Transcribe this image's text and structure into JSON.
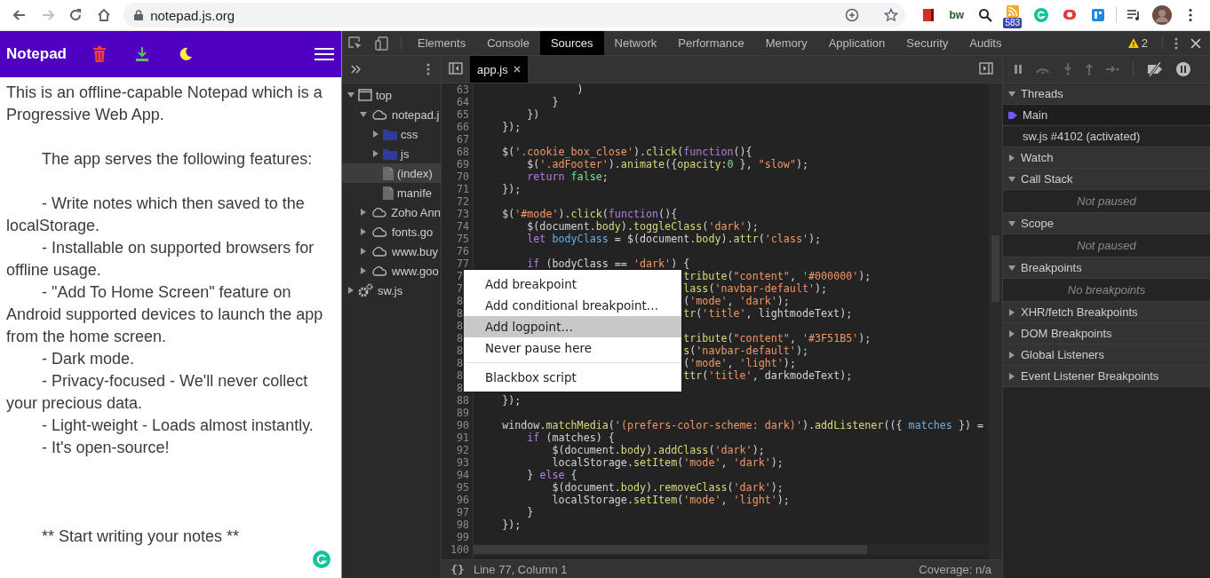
{
  "browser": {
    "address": "notepad.js.org",
    "extension_label": "bw",
    "extension_badge": "583"
  },
  "notepad": {
    "title": "Notepad",
    "text": "This is an offline-capable Notepad which is a Progressive Web App.\n\n\tThe app serves the following features:\n\n\t- Write notes which then saved to the localStorage.\n\t- Installable on supported browsers for offline usage.\n\t- \"Add To Home Screen\" feature on Android supported devices to launch the app from the home screen.\n\t- Dark mode.\n\t- Privacy-focused - We'll never collect your precious data.\n\t- Light-weight - Loads almost instantly.\n\t- It's open-source!\n\n\n\n\t** Start writing your notes **"
  },
  "devtools": {
    "tabs": [
      {
        "label": "Elements",
        "selected": false
      },
      {
        "label": "Console",
        "selected": false
      },
      {
        "label": "Sources",
        "selected": true
      },
      {
        "label": "Network",
        "selected": false
      },
      {
        "label": "Performance",
        "selected": false
      },
      {
        "label": "Memory",
        "selected": false
      },
      {
        "label": "Application",
        "selected": false
      },
      {
        "label": "Security",
        "selected": false
      },
      {
        "label": "Audits",
        "selected": false
      }
    ],
    "warning_count": "2",
    "navigator": {
      "tree": [
        {
          "label": "top",
          "kind": "frame",
          "expanded": true,
          "selected": false,
          "children": [
            {
              "label": "notepad.j",
              "kind": "origin",
              "expanded": true,
              "selected": false,
              "children": [
                {
                  "label": "css",
                  "kind": "folder",
                  "expanded": false,
                  "selected": false
                },
                {
                  "label": "js",
                  "kind": "folder",
                  "expanded": false,
                  "selected": false
                },
                {
                  "label": "(index)",
                  "kind": "file",
                  "selected": true
                },
                {
                  "label": "manife",
                  "kind": "file",
                  "selected": false
                }
              ]
            },
            {
              "label": "Zoho Ann",
              "kind": "origin",
              "expanded": false,
              "selected": false
            },
            {
              "label": "fonts.go",
              "kind": "origin",
              "expanded": false,
              "selected": false
            },
            {
              "label": "www.buy",
              "kind": "origin",
              "expanded": false,
              "selected": false
            },
            {
              "label": "www.goo",
              "kind": "origin",
              "expanded": false,
              "selected": false
            }
          ]
        },
        {
          "label": "sw.js",
          "kind": "worker",
          "expanded": false,
          "selected": false
        }
      ]
    },
    "editor": {
      "tabs": [
        {
          "label": "app.js",
          "selected": true
        }
      ],
      "lines": [
        {
          "number": "63",
          "tokens": [
            {
              "text": "                )",
              "kind": "plain"
            }
          ]
        },
        {
          "number": "64",
          "tokens": [
            {
              "text": "            }",
              "kind": "plain"
            }
          ]
        },
        {
          "number": "65",
          "tokens": [
            {
              "text": "        })",
              "kind": "plain"
            }
          ]
        },
        {
          "number": "66",
          "tokens": [
            {
              "text": "    });",
              "kind": "plain"
            }
          ]
        },
        {
          "number": "67"
        },
        {
          "number": "68",
          "tokens": [
            {
              "text": "    $(",
              "kind": "plain"
            },
            {
              "text": "'.cookie_box_close'",
              "kind": "string"
            },
            {
              "text": ").",
              "kind": "plain"
            },
            {
              "text": "click",
              "kind": "method"
            },
            {
              "text": "(",
              "kind": "plain"
            },
            {
              "text": "function",
              "kind": "keyword"
            },
            {
              "text": "(){",
              "kind": "plain"
            }
          ]
        },
        {
          "number": "69",
          "tokens": [
            {
              "text": "        $(",
              "kind": "plain"
            },
            {
              "text": "'.adFooter'",
              "kind": "string"
            },
            {
              "text": ").",
              "kind": "plain"
            },
            {
              "text": "animate",
              "kind": "method"
            },
            {
              "text": "({",
              "kind": "plain"
            },
            {
              "text": "opacity",
              "kind": "method"
            },
            {
              "text": ":",
              "kind": "plain"
            },
            {
              "text": "0",
              "kind": "literal"
            },
            {
              "text": " }, ",
              "kind": "plain"
            },
            {
              "text": "\"slow\"",
              "kind": "string"
            },
            {
              "text": ");",
              "kind": "plain"
            }
          ]
        },
        {
          "number": "70",
          "tokens": [
            {
              "text": "        return",
              "kind": "keyword"
            },
            {
              "text": " false",
              "kind": "literal"
            },
            {
              "text": ";",
              "kind": "plain"
            }
          ]
        },
        {
          "number": "71",
          "tokens": [
            {
              "text": "    });",
              "kind": "plain"
            }
          ]
        },
        {
          "number": "72"
        },
        {
          "number": "73",
          "tokens": [
            {
              "text": "    $(",
              "kind": "plain"
            },
            {
              "text": "'#mode'",
              "kind": "string"
            },
            {
              "text": ").",
              "kind": "plain"
            },
            {
              "text": "click",
              "kind": "method"
            },
            {
              "text": "(",
              "kind": "plain"
            },
            {
              "text": "function",
              "kind": "keyword"
            },
            {
              "text": "(){",
              "kind": "plain"
            }
          ]
        },
        {
          "number": "74",
          "tokens": [
            {
              "text": "        $(document.",
              "kind": "plain"
            },
            {
              "text": "body",
              "kind": "method"
            },
            {
              "text": ").",
              "kind": "plain"
            },
            {
              "text": "toggleClass",
              "kind": "method"
            },
            {
              "text": "(",
              "kind": "plain"
            },
            {
              "text": "'dark'",
              "kind": "string"
            },
            {
              "text": ");",
              "kind": "plain"
            }
          ]
        },
        {
          "number": "75",
          "tokens": [
            {
              "text": "        let",
              "kind": "keyword"
            },
            {
              "text": " bodyClass",
              "kind": "variable"
            },
            {
              "text": " = $(document.",
              "kind": "plain"
            },
            {
              "text": "body",
              "kind": "method"
            },
            {
              "text": ").",
              "kind": "plain"
            },
            {
              "text": "attr",
              "kind": "method"
            },
            {
              "text": "(",
              "kind": "plain"
            },
            {
              "text": "'class'",
              "kind": "string"
            },
            {
              "text": ");",
              "kind": "plain"
            }
          ]
        },
        {
          "number": "76"
        },
        {
          "number": "77",
          "tokens": [
            {
              "text": "        if",
              "kind": "keyword"
            },
            {
              "text": " (bodyClass == ",
              "kind": "plain"
            },
            {
              "text": "'dark'",
              "kind": "string"
            },
            {
              "text": ") {",
              "kind": "plain"
            }
          ]
        },
        {
          "number": "7",
          "tokens": [
            {
              "text": "                                 tribute",
              "kind": "method"
            },
            {
              "text": "(",
              "kind": "plain"
            },
            {
              "text": "\"content\"",
              "kind": "string"
            },
            {
              "text": ", ",
              "kind": "plain"
            },
            {
              "text": "'#000000'",
              "kind": "string"
            },
            {
              "text": ");",
              "kind": "plain"
            }
          ]
        },
        {
          "number": "7",
          "tokens": [
            {
              "text": "                                 lass",
              "kind": "method"
            },
            {
              "text": "(",
              "kind": "plain"
            },
            {
              "text": "'navbar-default'",
              "kind": "string"
            },
            {
              "text": ");",
              "kind": "plain"
            }
          ]
        },
        {
          "number": "8",
          "tokens": [
            {
              "text": "                                 (",
              "kind": "plain"
            },
            {
              "text": "'mode'",
              "kind": "string"
            },
            {
              "text": ", ",
              "kind": "plain"
            },
            {
              "text": "'dark'",
              "kind": "string"
            },
            {
              "text": ");",
              "kind": "plain"
            }
          ]
        },
        {
          "number": "8",
          "tokens": [
            {
              "text": "                                 tr",
              "kind": "method"
            },
            {
              "text": "(",
              "kind": "plain"
            },
            {
              "text": "'title'",
              "kind": "string"
            },
            {
              "text": ", lightmodeText);",
              "kind": "plain"
            }
          ]
        },
        {
          "number": "8"
        },
        {
          "number": "8",
          "tokens": [
            {
              "text": "                                 tribute",
              "kind": "method"
            },
            {
              "text": "(",
              "kind": "plain"
            },
            {
              "text": "\"content\"",
              "kind": "string"
            },
            {
              "text": ", ",
              "kind": "plain"
            },
            {
              "text": "'#3F51B5'",
              "kind": "string"
            },
            {
              "text": ");",
              "kind": "plain"
            }
          ]
        },
        {
          "number": "8",
          "tokens": [
            {
              "text": "                                 s",
              "kind": "method"
            },
            {
              "text": "(",
              "kind": "plain"
            },
            {
              "text": "'navbar-default'",
              "kind": "string"
            },
            {
              "text": ");",
              "kind": "plain"
            }
          ]
        },
        {
          "number": "8",
          "tokens": [
            {
              "text": "                                 (",
              "kind": "plain"
            },
            {
              "text": "'mode'",
              "kind": "string"
            },
            {
              "text": ", ",
              "kind": "plain"
            },
            {
              "text": "'light'",
              "kind": "string"
            },
            {
              "text": ");",
              "kind": "plain"
            }
          ]
        },
        {
          "number": "8",
          "tokens": [
            {
              "text": "                                 ttr",
              "kind": "method"
            },
            {
              "text": "(",
              "kind": "plain"
            },
            {
              "text": "'title'",
              "kind": "string"
            },
            {
              "text": ", darkmodeText);",
              "kind": "plain"
            }
          ]
        },
        {
          "number": "8"
        },
        {
          "number": "88",
          "tokens": [
            {
              "text": "    });",
              "kind": "plain"
            }
          ]
        },
        {
          "number": "89"
        },
        {
          "number": "90",
          "tokens": [
            {
              "text": "    window.",
              "kind": "plain"
            },
            {
              "text": "matchMedia",
              "kind": "method"
            },
            {
              "text": "(",
              "kind": "plain"
            },
            {
              "text": "'(prefers-color-scheme: dark)'",
              "kind": "string"
            },
            {
              "text": ").",
              "kind": "plain"
            },
            {
              "text": "addListener",
              "kind": "method"
            },
            {
              "text": "(({ ",
              "kind": "plain"
            },
            {
              "text": "matches",
              "kind": "variable"
            },
            {
              "text": " }) =",
              "kind": "plain"
            }
          ]
        },
        {
          "number": "91",
          "tokens": [
            {
              "text": "        if",
              "kind": "keyword"
            },
            {
              "text": " (matches) {",
              "kind": "plain"
            }
          ]
        },
        {
          "number": "92",
          "tokens": [
            {
              "text": "            $(document.",
              "kind": "plain"
            },
            {
              "text": "body",
              "kind": "method"
            },
            {
              "text": ").",
              "kind": "plain"
            },
            {
              "text": "addClass",
              "kind": "method"
            },
            {
              "text": "(",
              "kind": "plain"
            },
            {
              "text": "'dark'",
              "kind": "string"
            },
            {
              "text": ");",
              "kind": "plain"
            }
          ]
        },
        {
          "number": "93",
          "tokens": [
            {
              "text": "            localStorage.",
              "kind": "plain"
            },
            {
              "text": "setItem",
              "kind": "method"
            },
            {
              "text": "(",
              "kind": "plain"
            },
            {
              "text": "'mode'",
              "kind": "string"
            },
            {
              "text": ", ",
              "kind": "plain"
            },
            {
              "text": "'dark'",
              "kind": "string"
            },
            {
              "text": ");",
              "kind": "plain"
            }
          ]
        },
        {
          "number": "94",
          "tokens": [
            {
              "text": "        } ",
              "kind": "plain"
            },
            {
              "text": "else",
              "kind": "keyword"
            },
            {
              "text": " {",
              "kind": "plain"
            }
          ]
        },
        {
          "number": "95",
          "tokens": [
            {
              "text": "            $(document.",
              "kind": "plain"
            },
            {
              "text": "body",
              "kind": "method"
            },
            {
              "text": ").",
              "kind": "plain"
            },
            {
              "text": "removeClass",
              "kind": "method"
            },
            {
              "text": "(",
              "kind": "plain"
            },
            {
              "text": "'dark'",
              "kind": "string"
            },
            {
              "text": ");",
              "kind": "plain"
            }
          ]
        },
        {
          "number": "96",
          "tokens": [
            {
              "text": "            localStorage.",
              "kind": "plain"
            },
            {
              "text": "setItem",
              "kind": "method"
            },
            {
              "text": "(",
              "kind": "plain"
            },
            {
              "text": "'mode'",
              "kind": "string"
            },
            {
              "text": ", ",
              "kind": "plain"
            },
            {
              "text": "'light'",
              "kind": "string"
            },
            {
              "text": ");",
              "kind": "plain"
            }
          ]
        },
        {
          "number": "97",
          "tokens": [
            {
              "text": "        }",
              "kind": "plain"
            }
          ]
        },
        {
          "number": "98",
          "tokens": [
            {
              "text": "    });",
              "kind": "plain"
            }
          ]
        },
        {
          "number": "99"
        },
        {
          "number": "100"
        }
      ],
      "context_menu": [
        {
          "kind": "item",
          "label": "Add breakpoint",
          "highlighted": false
        },
        {
          "kind": "item",
          "label": "Add conditional breakpoint…",
          "highlighted": false
        },
        {
          "kind": "item",
          "label": "Add logpoint…",
          "highlighted": true
        },
        {
          "kind": "item",
          "label": "Never pause here",
          "highlighted": false
        },
        {
          "kind": "separator"
        },
        {
          "kind": "item",
          "label": "Blackbox script",
          "highlighted": false
        }
      ],
      "status": {
        "format_button": "{}",
        "position": "Line 77, Column 1",
        "coverage": "Coverage: n/a"
      }
    },
    "debugger": {
      "sections": [
        {
          "title": "Threads",
          "expanded": true,
          "items": [
            {
              "label": "Main",
              "selected": true
            },
            {
              "label": "sw.js #4102 (activated)",
              "selected": false
            }
          ]
        },
        {
          "title": "Watch",
          "expanded": false
        },
        {
          "title": "Call Stack",
          "expanded": true,
          "placeholder": "Not paused"
        },
        {
          "title": "Scope",
          "expanded": true,
          "placeholder": "Not paused"
        },
        {
          "title": "Breakpoints",
          "expanded": true,
          "placeholder": "No breakpoints"
        },
        {
          "title": "XHR/fetch Breakpoints",
          "expanded": false
        },
        {
          "title": "DOM Breakpoints",
          "expanded": false
        },
        {
          "title": "Global Listeners",
          "expanded": false
        },
        {
          "title": "Event Listener Breakpoints",
          "expanded": false
        }
      ]
    }
  }
}
